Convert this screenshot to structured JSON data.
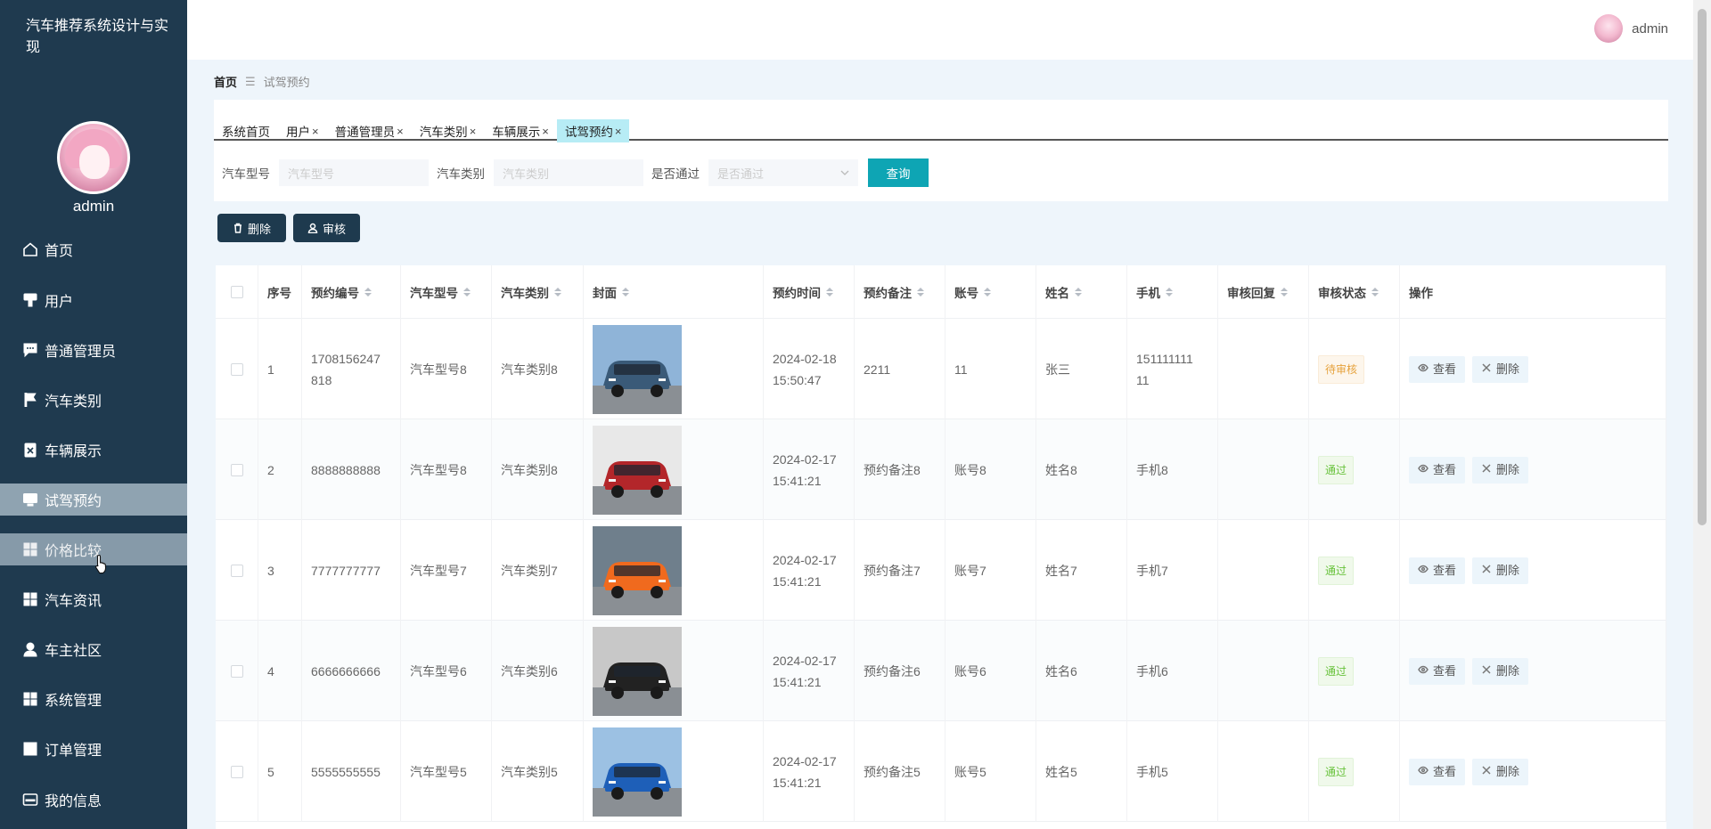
{
  "app": {
    "title": "汽车推荐系统设计与实现"
  },
  "sidebar": {
    "user_name": "admin",
    "items": [
      {
        "label": "首页",
        "icon": "home-icon"
      },
      {
        "label": "用户",
        "icon": "user-card-icon"
      },
      {
        "label": "普通管理员",
        "icon": "chat-icon"
      },
      {
        "label": "汽车类别",
        "icon": "flag-icon"
      },
      {
        "label": "车辆展示",
        "icon": "clipboard-icon"
      },
      {
        "label": "试驾预约",
        "icon": "monitor-icon"
      },
      {
        "label": "价格比较",
        "icon": "grid-icon"
      },
      {
        "label": "汽车资讯",
        "icon": "grid-icon"
      },
      {
        "label": "车主社区",
        "icon": "person-icon"
      },
      {
        "label": "系统管理",
        "icon": "grid-icon"
      },
      {
        "label": "订单管理",
        "icon": "apps-icon"
      },
      {
        "label": "我的信息",
        "icon": "id-card-icon"
      }
    ],
    "active_index": 5,
    "hover_index": 6
  },
  "header": {
    "user_name": "admin"
  },
  "breadcrumb": {
    "home": "首页",
    "separator": "☰",
    "current": "试驾预约"
  },
  "tabs": [
    {
      "label": "系统首页",
      "closable": false
    },
    {
      "label": "用户",
      "closable": true
    },
    {
      "label": "普通管理员",
      "closable": true
    },
    {
      "label": "汽车类别",
      "closable": true
    },
    {
      "label": "车辆展示",
      "closable": true
    },
    {
      "label": "试驾预约",
      "closable": true
    }
  ],
  "search": {
    "model_label": "汽车型号",
    "model_placeholder": "汽车型号",
    "category_label": "汽车类别",
    "category_placeholder": "汽车类别",
    "passed_label": "是否通过",
    "passed_placeholder": "是否通过",
    "query_button": "查询"
  },
  "actions": {
    "delete": "删除",
    "review": "审核"
  },
  "table": {
    "headers": [
      "序号",
      "预约编号",
      "汽车型号",
      "汽车类别",
      "封面",
      "预约时间",
      "预约备注",
      "账号",
      "姓名",
      "手机",
      "审核回复",
      "审核状态",
      "操作"
    ],
    "view_label": "查看",
    "delete_label": "删除",
    "rows": [
      {
        "index": "1",
        "code_a": "1708156247",
        "code_b": "818",
        "model": "汽车型号8",
        "category": "汽车类别8",
        "date": "2024-02-18",
        "time": "15:50:47",
        "note": "2211",
        "account": "11",
        "name": "张三",
        "phone_a": "151111111",
        "phone_b": "11",
        "reply": "",
        "status": "待审核",
        "status_type": "pending",
        "car_color": "#3a5a78",
        "bg": "#8fb4d8"
      },
      {
        "index": "2",
        "code_a": "8888888888",
        "code_b": "",
        "model": "汽车型号8",
        "category": "汽车类别8",
        "date": "2024-02-17",
        "time": "15:41:21",
        "note": "预约备注8",
        "account": "账号8",
        "name": "姓名8",
        "phone_a": "手机8",
        "phone_b": "",
        "reply": "",
        "status": "通过",
        "status_type": "pass",
        "car_color": "#b3262a",
        "bg": "#e8e8e8"
      },
      {
        "index": "3",
        "code_a": "7777777777",
        "code_b": "",
        "model": "汽车型号7",
        "category": "汽车类别7",
        "date": "2024-02-17",
        "time": "15:41:21",
        "note": "预约备注7",
        "account": "账号7",
        "name": "姓名7",
        "phone_a": "手机7",
        "phone_b": "",
        "reply": "",
        "status": "通过",
        "status_type": "pass",
        "car_color": "#f06a1e",
        "bg": "#6f7f8c"
      },
      {
        "index": "4",
        "code_a": "6666666666",
        "code_b": "",
        "model": "汽车型号6",
        "category": "汽车类别6",
        "date": "2024-02-17",
        "time": "15:41:21",
        "note": "预约备注6",
        "account": "账号6",
        "name": "姓名6",
        "phone_a": "手机6",
        "phone_b": "",
        "reply": "",
        "status": "通过",
        "status_type": "pass",
        "car_color": "#222222",
        "bg": "#c8c8c8"
      },
      {
        "index": "5",
        "code_a": "5555555555",
        "code_b": "",
        "model": "汽车型号5",
        "category": "汽车类别5",
        "date": "2024-02-17",
        "time": "15:41:21",
        "note": "预约备注5",
        "account": "账号5",
        "name": "姓名5",
        "phone_a": "手机5",
        "phone_b": "",
        "reply": "",
        "status": "通过",
        "status_type": "pass",
        "car_color": "#1e5fb8",
        "bg": "#9cc1e3"
      }
    ]
  }
}
